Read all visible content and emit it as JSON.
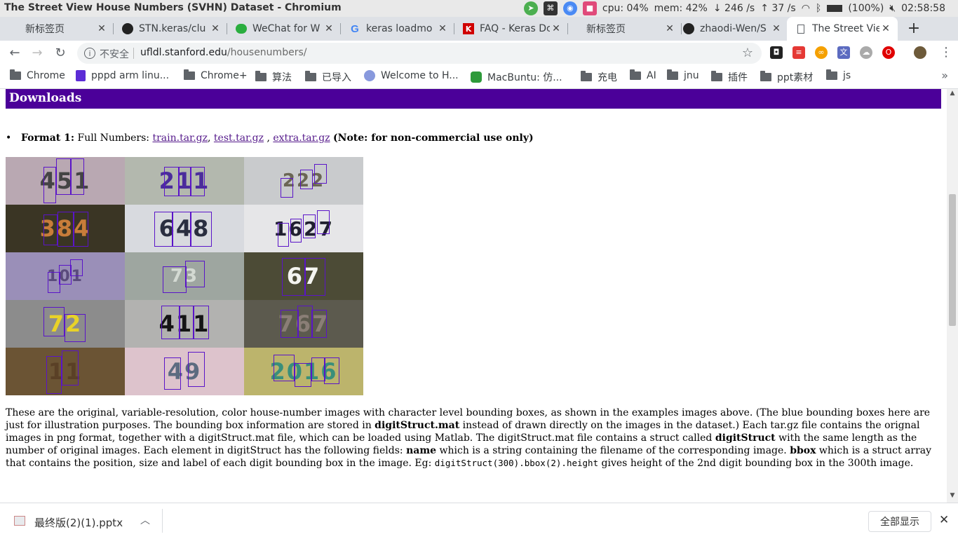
{
  "os_bar": {
    "window_title": "The Street View House Numbers (SVHN) Dataset - Chromium",
    "cpu": "cpu: 04%",
    "mem": "mem: 42%",
    "net_down": "↓ 246 /s",
    "net_up": "↑ 37 /s",
    "battery": "(100%)",
    "clock": "02:58:58"
  },
  "tabs": [
    {
      "title": "新标签页",
      "icon": "blank-icon",
      "active": false
    },
    {
      "title": "STN.keras/clu",
      "icon": "github-icon",
      "active": false
    },
    {
      "title": "WeChat for W",
      "icon": "wechat-icon",
      "active": false
    },
    {
      "title": "keras loadmo",
      "icon": "google-icon",
      "active": false
    },
    {
      "title": "FAQ - Keras Dc",
      "icon": "keras-icon",
      "active": false
    },
    {
      "title": "新标签页",
      "icon": "blank-icon",
      "active": false
    },
    {
      "title": "zhaodi-Wen/S",
      "icon": "github-icon",
      "active": false
    },
    {
      "title": "The Street Vie",
      "icon": "page-icon",
      "active": true
    }
  ],
  "toolbar": {
    "security_label": "不安全",
    "url_host": "ufldl.stanford.edu",
    "url_path": "/housenumbers/"
  },
  "bookmarks": [
    {
      "label": "Chrome",
      "icon": "folder-icon"
    },
    {
      "label": "pppd arm linu...",
      "icon": "bookmark-icon"
    },
    {
      "label": "Chrome+",
      "icon": "folder-icon"
    },
    {
      "label": "算法",
      "icon": "folder-icon"
    },
    {
      "label": "已导入",
      "icon": "folder-icon"
    },
    {
      "label": "Welcome to H...",
      "icon": "globe-icon"
    },
    {
      "label": "MacBuntu: 仿...",
      "icon": "macbuntu-icon"
    },
    {
      "label": "充电",
      "icon": "folder-icon"
    },
    {
      "label": "AI",
      "icon": "folder-icon"
    },
    {
      "label": "jnu",
      "icon": "folder-icon"
    },
    {
      "label": "插件",
      "icon": "folder-icon"
    },
    {
      "label": "ppt素材",
      "icon": "folder-icon"
    },
    {
      "label": "js",
      "icon": "folder-icon"
    }
  ],
  "page": {
    "section_heading": "Downloads",
    "format_label": "Format 1:",
    "format_desc": "Full Numbers:",
    "link_train": "train.tar.gz",
    "link_test": "test.tar.gz",
    "link_extra": "extra.tar.gz",
    "note": "(Note: for non-commercial use only)",
    "sample_numbers": [
      "451",
      "211",
      "222",
      "384",
      "648",
      "1627",
      "101",
      "73",
      "67",
      "72",
      "411",
      "767",
      "11",
      "49",
      "2016"
    ],
    "desc_1": "These are the original, variable-resolution, color house-number images with character level bounding boxes, as shown in the examples images above. (The blue bounding boxes here are just for illustration purposes. The bounding box information are stored in ",
    "desc_b1": "digitStruct.mat",
    "desc_2": " instead of drawn directly on the images in the dataset.) Each tar.gz file contains the orignal images in png format, together with a digitStruct.mat file, which can be loaded using Matlab. The digitStruct.mat file contains a struct called ",
    "desc_b2": "digitStruct",
    "desc_3": " with the same length as the number of original images. Each element in digitStruct has the following fields: ",
    "desc_b3": "name",
    "desc_4": " which is a string containing the filename of the corresponding image. ",
    "desc_b4": "bbox",
    "desc_5": " which is a struct array that contains the position, size and label of each digit bounding box in the image. Eg: ",
    "desc_code": "digitStruct(300).bbox(2).height",
    "desc_6": " gives height of the 2nd digit bounding box in the 300th image."
  },
  "download_bar": {
    "file_name": "最终版(2)(1).pptx",
    "show_all": "全部显示"
  }
}
